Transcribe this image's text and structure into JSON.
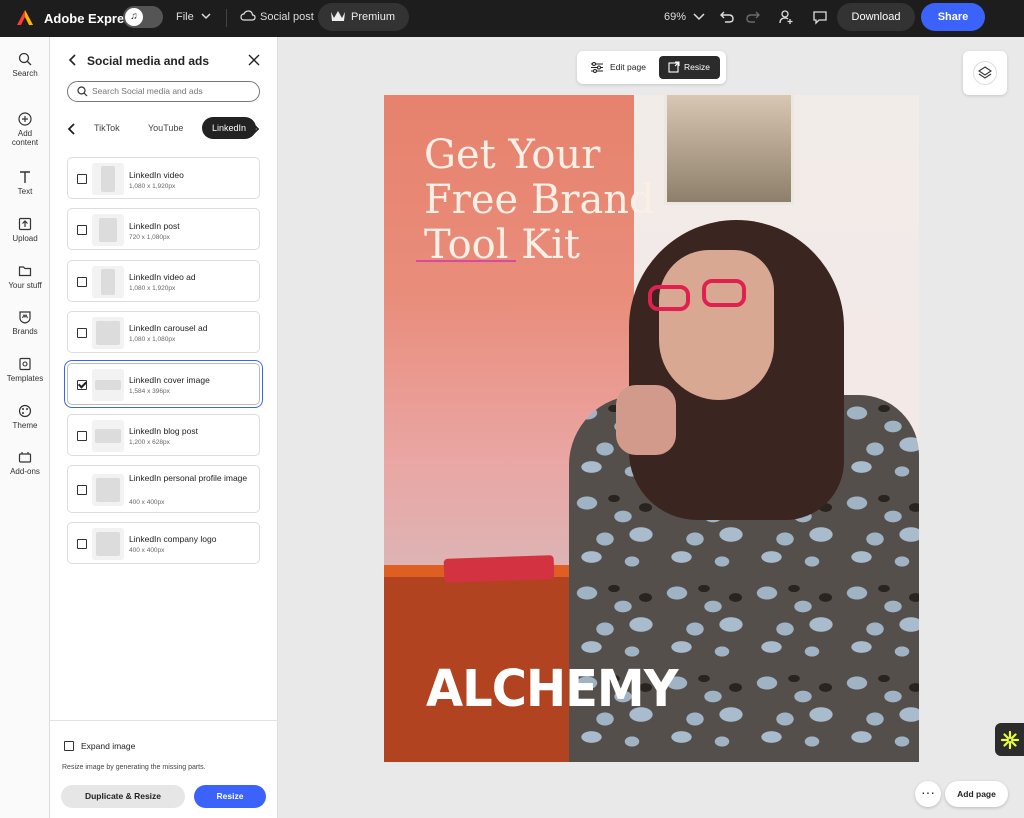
{
  "app": {
    "name": "Adobe Express",
    "file_menu": "File",
    "doc_type": "Social post",
    "premium": "Premium",
    "zoom": "69%",
    "download": "Download",
    "share": "Share"
  },
  "rail": {
    "items": [
      {
        "label": "Search"
      },
      {
        "label": "Add\ncontent"
      },
      {
        "label": "Text"
      },
      {
        "label": "Upload"
      },
      {
        "label": "Your stuff"
      },
      {
        "label": "Brands"
      },
      {
        "label": "Templates"
      },
      {
        "label": "Theme"
      },
      {
        "label": "Add-ons"
      }
    ]
  },
  "panel": {
    "title": "Social media and ads",
    "search_placeholder": "Search Social media and ads",
    "tabs": [
      "TikTok",
      "YouTube",
      "LinkedIn"
    ],
    "active_tab": "LinkedIn",
    "formats": [
      {
        "name": "LinkedIn video",
        "dims": "1,080 x 1,920px",
        "checked": false
      },
      {
        "name": "LinkedIn post",
        "dims": "720 x 1,080px",
        "checked": false
      },
      {
        "name": "LinkedIn video ad",
        "dims": "1,080 x 1,920px",
        "checked": false
      },
      {
        "name": "LinkedIn carousel ad",
        "dims": "1,080 x 1,080px",
        "checked": false
      },
      {
        "name": "LinkedIn cover image",
        "dims": "1,584 x 396px",
        "checked": true
      },
      {
        "name": "LinkedIn blog post",
        "dims": "1,200 x 628px",
        "checked": false
      },
      {
        "name": "LinkedIn personal profile image",
        "dims": "400 x 400px",
        "checked": false
      },
      {
        "name": "LinkedIn company logo",
        "dims": "400 x 400px",
        "checked": false
      }
    ],
    "expand_label": "Expand image",
    "expand_help": "Resize image by generating the missing parts.",
    "duplicate_resize": "Duplicate & Resize",
    "resize": "Resize"
  },
  "canvas": {
    "edit_page": "Edit page",
    "resize_tab": "Resize",
    "headline_line1": "Get Your",
    "headline_line2": "Free Brand",
    "headline_line3": "Tool Kit",
    "brand_logo": "ALCHEMY",
    "add_page": "Add page"
  },
  "colors": {
    "accent": "#3b63fb",
    "topbar": "#1d1d1d",
    "glasses": "#e22050"
  }
}
